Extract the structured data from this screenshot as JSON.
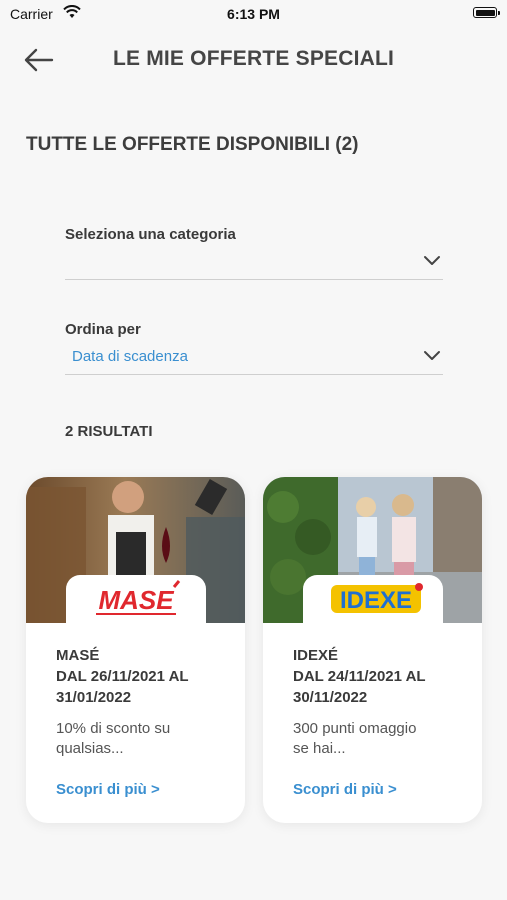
{
  "status": {
    "carrier": "Carrier",
    "time": "6:13 PM"
  },
  "header": {
    "title": "LE MIE OFFERTE SPECIALI"
  },
  "section": {
    "title": "TUTTE LE OFFERTE DISPONIBILI (2)"
  },
  "filters": {
    "category": {
      "label": "Seleziona una categoria",
      "value": ""
    },
    "sort": {
      "label": "Ordina per",
      "value": "Data di scadenza"
    }
  },
  "results": {
    "count_label": "2 RISULTATI"
  },
  "offers": [
    {
      "brand": "MASÉ",
      "logo_text": "MASE",
      "logo_color": "#e0282e",
      "date_line1": "DAL 26/11/2021 AL",
      "date_line2": "31/01/2022",
      "desc_line1": "10% di sconto su",
      "desc_line2": "qualsias...",
      "link": "Scopri di più >"
    },
    {
      "brand": "IDEXÉ",
      "logo_text": "IDEXE",
      "logo_colors": [
        "#f4c200",
        "#1f6fd1",
        "#e0282e"
      ],
      "date_line1": "DAL 24/11/2021 AL",
      "date_line2": "30/11/2022",
      "desc_line1": "300 punti omaggio",
      "desc_line2": "se hai...",
      "link": "Scopri di più >"
    }
  ],
  "colors": {
    "accent": "#3a8fd0",
    "background": "#f7f7f7"
  }
}
